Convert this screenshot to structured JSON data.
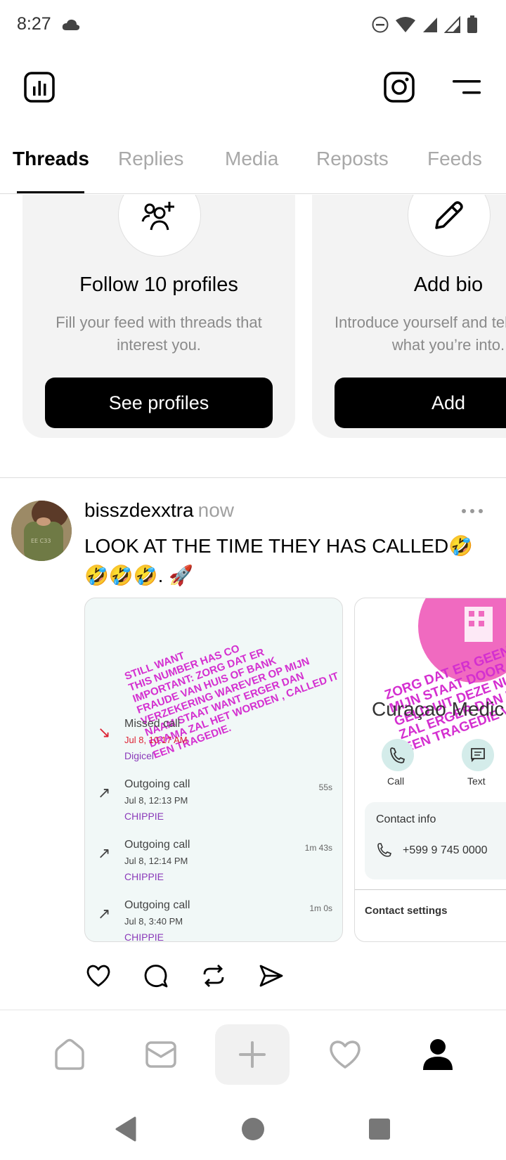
{
  "status": {
    "time": "8:27",
    "icons": [
      "cloud-icon",
      "do-not-disturb-icon",
      "wifi-icon",
      "signal-icon",
      "signal-icon-2",
      "battery-icon"
    ]
  },
  "header": {
    "icons": [
      "insights-icon",
      "instagram-icon",
      "menu-icon"
    ]
  },
  "tabs": [
    "Threads",
    "Replies",
    "Media",
    "Reposts",
    "Feeds"
  ],
  "active_tab": "Threads",
  "cards": [
    {
      "title": "Follow 10 profiles",
      "desc": "Fill your feed with threads that interest you.",
      "button": "See profiles",
      "icon": "add-people-icon"
    },
    {
      "title": "Add bio",
      "desc": "Introduce yourself and tell people what you’re into.",
      "button": "Add",
      "icon": "pencil-icon"
    }
  ],
  "post": {
    "username": "bisszdexxtra",
    "time": "now",
    "text_line1": "LOOK AT THE TIME THEY HAS CALLED🤣",
    "text_line2": "🤣🤣🤣. 🚀",
    "image1": {
      "stamp": [
        "STILL WANT",
        "THIS NUMBER HAS CO",
        "IMPORTANT: ZORG DAT ER",
        "FRAUDE VAN HUIS OF BANK",
        "VERZEKERING WAREVER OP MIJN",
        "NAAM STAAT WANT ERGER DAN",
        "DRAMA ZAL HET WORDEN , CALLED IT",
        "EEN TRAGEDIE."
      ],
      "calls": [
        {
          "type": "Missed call",
          "date": "Jul 8, 10:17 AM",
          "name": "Digicel",
          "duration": ""
        },
        {
          "type": "Outgoing call",
          "date": "Jul 8, 12:13 PM",
          "name": "CHIPPIE",
          "duration": "55s"
        },
        {
          "type": "Outgoing call",
          "date": "Jul 8, 12:14 PM",
          "name": "CHIPPIE",
          "duration": "1m 43s"
        },
        {
          "type": "Outgoing call",
          "date": "Jul 8, 3:40 PM",
          "name": "CHIPPIE",
          "duration": "1m 0s"
        }
      ]
    },
    "image2": {
      "title": "Curaçao Medic",
      "stamp": [
        "ZORG DAT ER GEEN FRA",
        "MIJN STAAT DOOR WIE",
        "GELD UIT DEZE NU",
        "ZAL ERGER DAN D",
        "EEN TRAGEDIE VE"
      ],
      "call_label": "Call",
      "text_label": "Text",
      "contact_info_label": "Contact info",
      "phone": "+599 9 745 0000",
      "contact_settings_label": "Contact settings"
    }
  },
  "actions": [
    "heart-icon",
    "comment-icon",
    "repost-icon",
    "share-icon"
  ],
  "bottom_nav": [
    "home-icon",
    "inbox-icon",
    "plus-icon",
    "activity-heart-icon",
    "profile-icon"
  ],
  "colors": {
    "accent": "#000000",
    "muted": "#a8a8a8",
    "card_bg": "#f3f3f3",
    "stamp": "#d42fd0"
  }
}
